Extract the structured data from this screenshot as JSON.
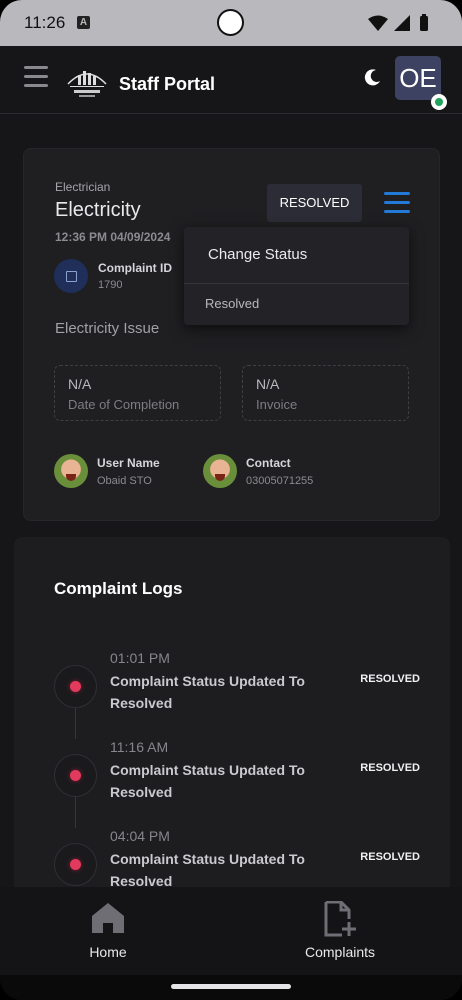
{
  "status_bar": {
    "time": "11:26",
    "notification_letter": "A"
  },
  "app_bar": {
    "title": "Staff Portal",
    "avatar_initials": "OE"
  },
  "complaint": {
    "category": "Electrician",
    "title": "Electricity",
    "datetime": "12:36 PM 04/09/2024",
    "status_button": "RESOLVED",
    "id_label": "Complaint ID",
    "id_value": "1790",
    "issue": "Electricity Issue",
    "completion": {
      "value": "N/A",
      "label": "Date of Completion"
    },
    "invoice": {
      "value": "N/A",
      "label": "Invoice"
    },
    "user": {
      "label": "User Name",
      "value": "Obaid STO"
    },
    "contact": {
      "label": "Contact",
      "value": "03005071255"
    }
  },
  "dropdown": {
    "title": "Change Status",
    "items": [
      "Resolved"
    ]
  },
  "logs": {
    "title": "Complaint Logs",
    "entries": [
      {
        "time": "01:01 PM",
        "text": "Complaint Status Updated To Resolved",
        "status": "RESOLVED"
      },
      {
        "time": "11:16 AM",
        "text": "Complaint Status Updated To Resolved",
        "status": "RESOLVED"
      },
      {
        "time": "04:04 PM",
        "text": "Complaint Status Updated To Resolved",
        "status": "RESOLVED"
      }
    ]
  },
  "bottom_nav": {
    "items": [
      {
        "label": "Home",
        "icon": "home-icon"
      },
      {
        "label": "Complaints",
        "icon": "complaint-add-icon"
      }
    ]
  },
  "colors": {
    "accent": "#2279d6",
    "status_dot": "#e23a5c",
    "online": "#1fa35d",
    "avatar_bg": "#3d4262"
  }
}
